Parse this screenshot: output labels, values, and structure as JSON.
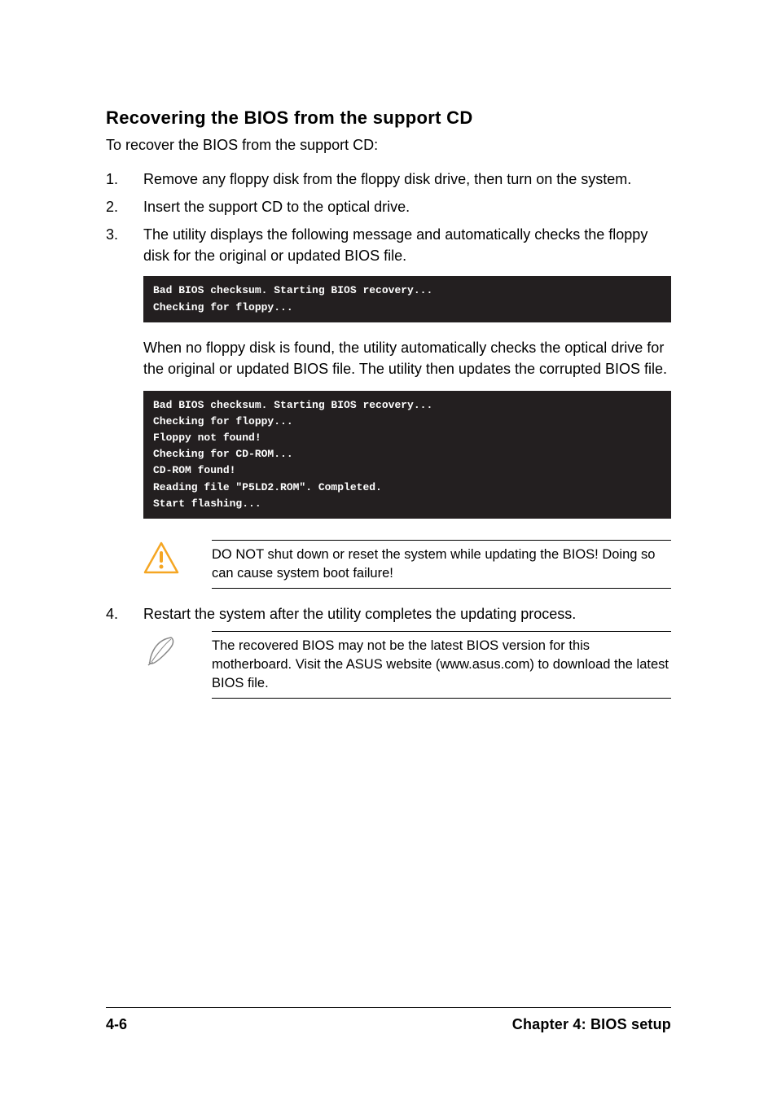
{
  "heading": "Recovering the BIOS from the support CD",
  "intro": "To recover the BIOS from the support CD:",
  "steps": [
    {
      "num": "1.",
      "text": "Remove any floppy disk from the floppy disk drive, then turn on the system."
    },
    {
      "num": "2.",
      "text": "Insert the support CD to the optical drive."
    },
    {
      "num": "3.",
      "text": "The utility displays the following message and automatically checks the floppy disk for the original or updated BIOS file."
    }
  ],
  "code1": "Bad BIOS checksum. Starting BIOS recovery...\nChecking for floppy...",
  "afterCode1": "When no floppy disk is found, the utility automatically checks the optical drive for the original or updated BIOS file. The utility then updates the corrupted BIOS file.",
  "code2": "Bad BIOS checksum. Starting BIOS recovery...\nChecking for floppy...\nFloppy not found!\nChecking for CD-ROM...\nCD-ROM found!\nReading file \"P5LD2.ROM\". Completed.\nStart flashing...",
  "warning": "DO NOT shut down or reset the system while updating the BIOS! Doing so can cause system boot failure!",
  "step4": {
    "num": "4.",
    "text": "Restart the system after the utility completes the updating process."
  },
  "note": "The recovered BIOS may not be the latest BIOS version for this motherboard. Visit the ASUS website (www.asus.com) to download the latest BIOS file.",
  "footer": {
    "left": "4-6",
    "right": "Chapter 4: BIOS setup"
  }
}
